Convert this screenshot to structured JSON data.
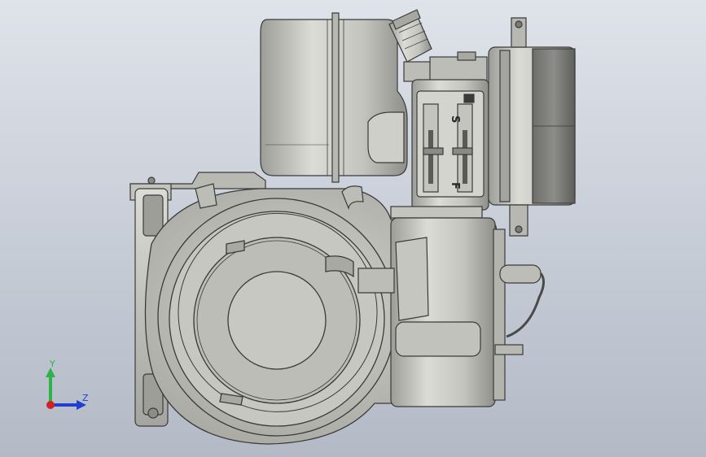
{
  "viewport": {
    "background_top": "#dfe3ea",
    "background_bottom": "#b3bac6"
  },
  "model": {
    "part_color": "#c8c8c4",
    "edge_color": "#3a3a3a",
    "throttle_plate": {
      "label_s": "S",
      "label_f": "F"
    }
  },
  "triad": {
    "y_label": "Y",
    "z_label": "Z",
    "y_color": "#2db34a",
    "z_color": "#1f3fd1",
    "x_color": "#d42020"
  }
}
